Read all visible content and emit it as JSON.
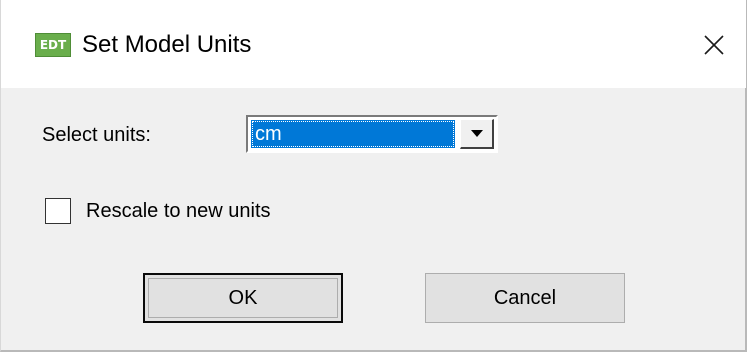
{
  "window": {
    "icon_text": "EDT",
    "title": "Set Model Units"
  },
  "form": {
    "units_label": "Select units:",
    "units_value": "cm",
    "rescale_label": "Rescale to new units",
    "rescale_checked": false
  },
  "buttons": {
    "ok": "OK",
    "cancel": "Cancel"
  },
  "colors": {
    "selection": "#0078d7",
    "dialog_bg": "#f0f0f0",
    "icon_bg": "#6aae4c"
  },
  "icons": {
    "close": "close-icon",
    "dropdown": "chevron-down-icon",
    "app": "edt-app-icon"
  }
}
